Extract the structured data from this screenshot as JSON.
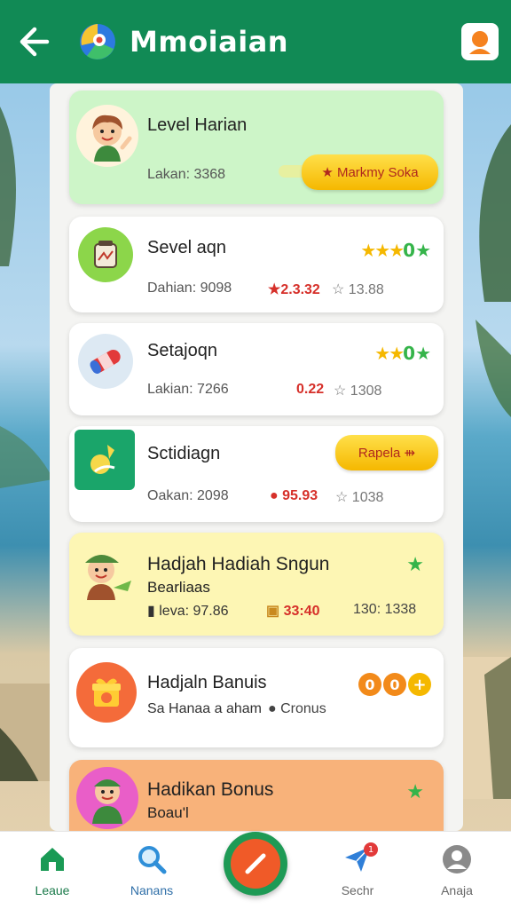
{
  "header": {
    "title": "Mmoiaian",
    "back_icon": "arrow-left-icon",
    "logo_icon": "app-logo-icon",
    "profile_icon": "profile-icon"
  },
  "cards": [
    {
      "title": "Level Harian",
      "subline": "Lakan: 3368",
      "button_label": "★ Markmy Soka",
      "icon": "kid-waving-avatar",
      "bg": "#cdf5c8"
    },
    {
      "title": "Sevel aqn",
      "subline": "Dahian: 9098",
      "stars": "★★★",
      "stars_tail": "0",
      "stars_end": "★",
      "value": "★2.3.32",
      "value_tail": "☆ 13.88",
      "icon": "jar-icon"
    },
    {
      "title": "Setajoqn",
      "subline": "Lakian: 7266",
      "stars": "★★",
      "stars_tail": "0",
      "stars_end": "★",
      "value": "0.22",
      "value_tail": "☆ 1308",
      "icon": "bandage-icon"
    },
    {
      "title": "Sctidiagn",
      "subline": "Oakan: 2098",
      "button_label": "Rapela ⇻",
      "value": "● 95.93",
      "value_tail": "☆ 1038",
      "icon": "hand-coin-icon"
    },
    {
      "title": "Hadjah Hadiah Sngun",
      "subtitle": "Bearliaas",
      "subline": "▮ leva: 97.86",
      "value": "33:40",
      "value_tail": "130: 1338",
      "star": "★",
      "icon": "kid-hat-avatar",
      "bg": "#fdf6b4"
    },
    {
      "title": "Hadjaln Banuis",
      "subline": "Sa Hanaa a aham",
      "value": "● Cronus",
      "badges": [
        "0",
        "0",
        "+"
      ],
      "icon": "gift-box-icon"
    },
    {
      "title": "Hadikan Bonus",
      "subtitle": "Boau'l",
      "star": "★",
      "icon": "kid-green-avatar",
      "bg": "#f8b27a"
    }
  ],
  "nav": [
    {
      "label": "Leaue",
      "icon": "home-icon"
    },
    {
      "label": "Nanans",
      "icon": "search-icon"
    },
    {
      "label": "Sechr",
      "icon": "paper-plane-icon",
      "badge": "1"
    },
    {
      "label": "Anaja",
      "icon": "user-icon"
    }
  ],
  "fab": {
    "icon": "pencil-icon"
  }
}
